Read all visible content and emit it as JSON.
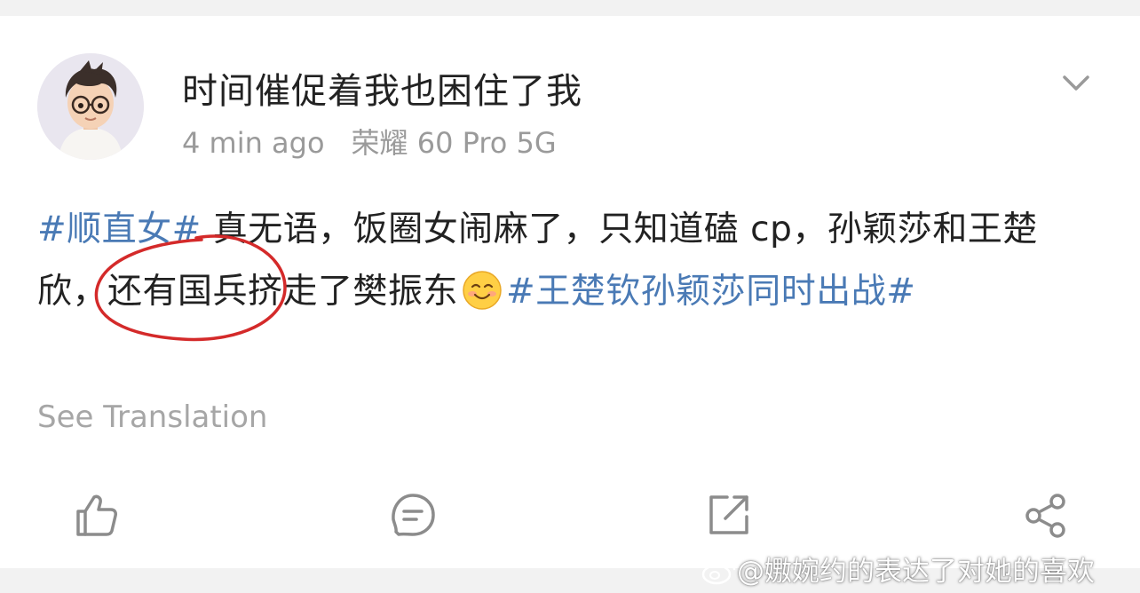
{
  "post": {
    "username": "时间催促着我也困住了我",
    "time": "4 min ago",
    "device": "荣耀 60 Pro 5G",
    "content": {
      "hashtag1": "#顺直女#",
      "text1": " 真无语，饭圈女闹麻了，只知道磕 cp，孙颖莎和王楚欣，还有国兵挤走了樊振东",
      "emoji": "smiling-face-icon",
      "hashtag2": "#王楚钦孙颖莎同时出战#"
    },
    "translate_label": "See Translation"
  },
  "actions": [
    "like-icon",
    "comment-icon",
    "repost-icon",
    "share-icon"
  ],
  "annotation": {
    "shape": "ellipse",
    "color": "#d42a2a"
  },
  "watermark": "@嫐婉约的表达了对她的喜欢",
  "colors": {
    "hashtag": "#4a7ab5",
    "text": "#222222",
    "meta": "#9a9a9a",
    "icon": "#8c8c8c",
    "background": "#f2f2f2"
  }
}
